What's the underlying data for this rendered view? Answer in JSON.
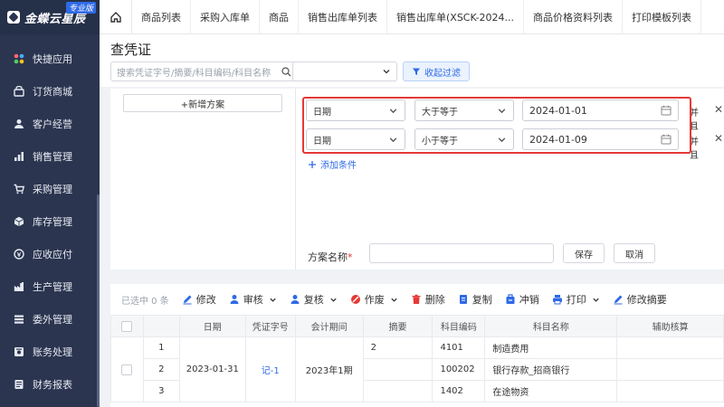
{
  "brand": {
    "name": "金蝶云星辰",
    "edition": "专业版"
  },
  "sidebar": {
    "items": [
      {
        "label": "快捷应用",
        "icon": "apps-icon"
      },
      {
        "label": "订货商城",
        "icon": "store-icon"
      },
      {
        "label": "客户经营",
        "icon": "customer-icon"
      },
      {
        "label": "销售管理",
        "icon": "sales-chart-icon"
      },
      {
        "label": "采购管理",
        "icon": "cart-icon"
      },
      {
        "label": "库存管理",
        "icon": "cube-icon"
      },
      {
        "label": "应收应付",
        "icon": "coin-icon"
      },
      {
        "label": "生产管理",
        "icon": "factory-icon"
      },
      {
        "label": "委外管理",
        "icon": "outsourcing-icon"
      },
      {
        "label": "账务处理",
        "icon": "ledger-icon"
      },
      {
        "label": "财务报表",
        "icon": "report-icon"
      }
    ]
  },
  "tabs": [
    "商品列表",
    "采购入库单",
    "商品",
    "销售出库单列表",
    "销售出库单(XSCK-2024...",
    "商品价格资料列表",
    "打印模板列表"
  ],
  "page": {
    "title": "查凭证",
    "search_placeholder": "搜索凭证字号/摘要/科目编码/科目名称",
    "scheme_select_value": "",
    "collapse_filter": "收起过滤"
  },
  "filter": {
    "add_scheme": "+新增方案",
    "conditions": [
      {
        "field": "日期",
        "operator": "大于等于",
        "value": "2024-01-01",
        "tail": "并且"
      },
      {
        "field": "日期",
        "operator": "小于等于",
        "value": "2024-01-09",
        "tail": "并且"
      }
    ],
    "add_condition": "添加条件",
    "scheme_name_label": "方案名称",
    "scheme_name_required": "*",
    "scheme_name_value": "",
    "save": "保存",
    "cancel": "取消"
  },
  "toolbar": {
    "selected": "已选中 0 条",
    "buttons": [
      {
        "label": "修改",
        "icon": "edit-icon",
        "dropdown": false
      },
      {
        "label": "审核",
        "icon": "audit-icon",
        "dropdown": true
      },
      {
        "label": "复核",
        "icon": "recheck-icon",
        "dropdown": true
      },
      {
        "label": "作废",
        "icon": "void-icon",
        "dropdown": true
      },
      {
        "label": "删除",
        "icon": "trash-icon",
        "dropdown": false
      },
      {
        "label": "复制",
        "icon": "copy-icon",
        "dropdown": false
      },
      {
        "label": "冲销",
        "icon": "reverse-icon",
        "dropdown": false
      },
      {
        "label": "打印",
        "icon": "print-icon",
        "dropdown": true
      },
      {
        "label": "修改摘要",
        "icon": "edit-icon",
        "dropdown": false
      }
    ]
  },
  "table": {
    "columns": [
      "",
      "",
      "日期",
      "凭证字号",
      "会计期间",
      "摘要",
      "科目编码",
      "科目名称",
      "辅助核算"
    ],
    "voucher": {
      "date": "2023-01-31",
      "number": "记-1",
      "period": "2023年1期"
    },
    "rows": [
      {
        "seq": "1",
        "summary": "2",
        "code": "4101",
        "name": "制造费用"
      },
      {
        "seq": "2",
        "summary": "",
        "code": "100202",
        "name": "银行存款_招商银行"
      },
      {
        "seq": "3",
        "summary": "",
        "code": "1402",
        "name": "在途物资"
      }
    ]
  },
  "colors": {
    "sidebar_bg": "#2b3550",
    "accent": "#2f6ae6",
    "highlight_border": "#e53935"
  }
}
